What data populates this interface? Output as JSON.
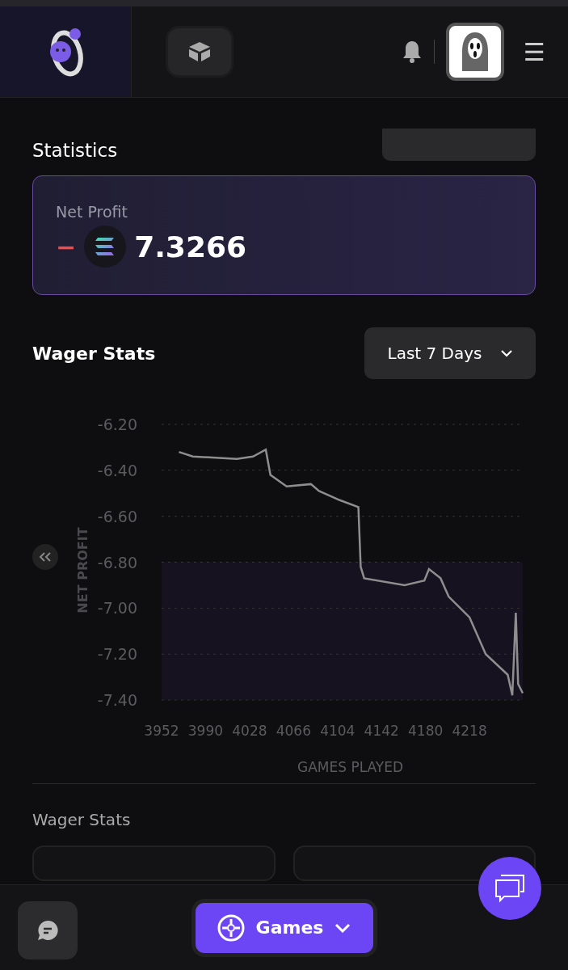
{
  "header": {
    "menu": "☰"
  },
  "statistics": {
    "title": "Statistics",
    "net_profit": {
      "label": "Net Profit",
      "sign": "−",
      "value": "7.3266",
      "negative": true
    }
  },
  "wager_stats": {
    "title": "Wager Stats",
    "range": "Last 7 Days",
    "chart_data": {
      "type": "line",
      "xlabel": "GAMES PLAYED",
      "ylabel": "NET PROFIT",
      "xticks": [
        3952,
        3990,
        4028,
        4066,
        4104,
        4142,
        4180,
        4218
      ],
      "yticks": [
        {
          "value": -6.2,
          "label": "-6.20"
        },
        {
          "value": -6.4,
          "label": "-6.40"
        },
        {
          "value": -6.6,
          "label": "-6.60"
        },
        {
          "value": -6.8,
          "label": "-6.80"
        },
        {
          "value": -7.0,
          "label": "-7.00"
        },
        {
          "value": -7.2,
          "label": "-7.20"
        },
        {
          "value": -7.4,
          "label": "-7.40"
        }
      ],
      "grid": true,
      "xlim": [
        3952,
        4264
      ],
      "ylim": [
        -7.4,
        -6.2
      ],
      "x": [
        3967,
        3979,
        4017,
        4031,
        4042,
        4046,
        4060,
        4081,
        4088,
        4106,
        4122,
        4124,
        4127,
        4162,
        4179,
        4183,
        4193,
        4200,
        4218,
        4232,
        4251,
        4255,
        4258,
        4260,
        4264
      ],
      "series": [
        {
          "color": "#8e8e8e",
          "values": [
            -6.32,
            -6.34,
            -6.35,
            -6.34,
            -6.31,
            -6.42,
            -6.47,
            -6.46,
            -6.49,
            -6.53,
            -6.56,
            -6.82,
            -6.87,
            -6.9,
            -6.88,
            -6.83,
            -6.87,
            -6.95,
            -7.04,
            -7.2,
            -7.29,
            -7.38,
            -7.02,
            -7.33,
            -7.37
          ]
        }
      ]
    }
  },
  "wager_stats_section": {
    "title": "Wager Stats"
  },
  "bottom_bar": {
    "games": "Games"
  }
}
